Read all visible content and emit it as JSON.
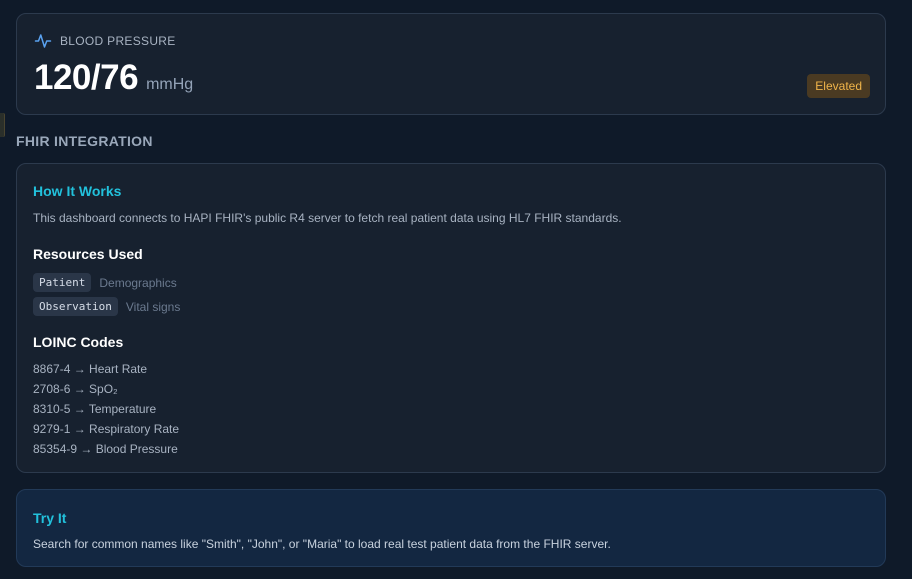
{
  "vital": {
    "icon": "heartbeat-pulse-icon",
    "label": "BLOOD PRESSURE",
    "value": "120/76",
    "unit": "mmHg",
    "status": "Elevated",
    "status_color": "#f0b44a"
  },
  "fhir": {
    "section_title": "FHIR INTEGRATION",
    "how_title": "How It Works",
    "how_description": "This dashboard connects to HAPI FHIR's public R4 server to fetch real patient data using HL7 FHIR standards.",
    "resources_title": "Resources Used",
    "resources": [
      {
        "code": "Patient",
        "description": "Demographics"
      },
      {
        "code": "Observation",
        "description": "Vital signs"
      }
    ],
    "loinc_title": "LOINC Codes",
    "loinc_codes": [
      "8867-4 → Heart Rate",
      "2708-6 → SpO₂",
      "8310-5 → Temperature",
      "9279-1 → Respiratory Rate",
      "85354-9 → Blood Pressure"
    ]
  },
  "try_it": {
    "title": "Try It",
    "description": "Search for common names like \"Smith\", \"John\", or \"Maria\" to load real test patient data from the FHIR server."
  },
  "colors": {
    "accent": "#22c1dc",
    "background": "#0f1a29",
    "card": "#17212f"
  }
}
